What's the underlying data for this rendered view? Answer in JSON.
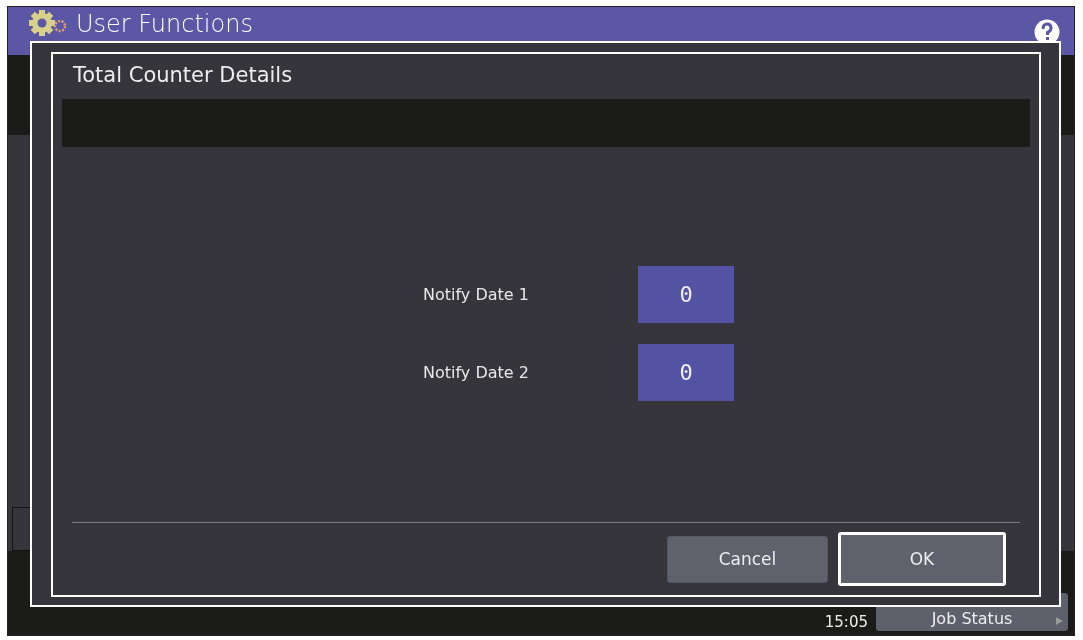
{
  "header": {
    "title": "User Functions"
  },
  "dialog": {
    "title": "Total Counter Details",
    "fields": [
      {
        "label": "Notify Date 1",
        "value": "0"
      },
      {
        "label": "Notify Date 2",
        "value": "0"
      }
    ],
    "buttons": [
      {
        "label": "Cancel",
        "selected": false
      },
      {
        "label": "OK",
        "selected": true
      }
    ]
  },
  "status_bar": {
    "time": "15:05",
    "job_status": "Job Status"
  }
}
